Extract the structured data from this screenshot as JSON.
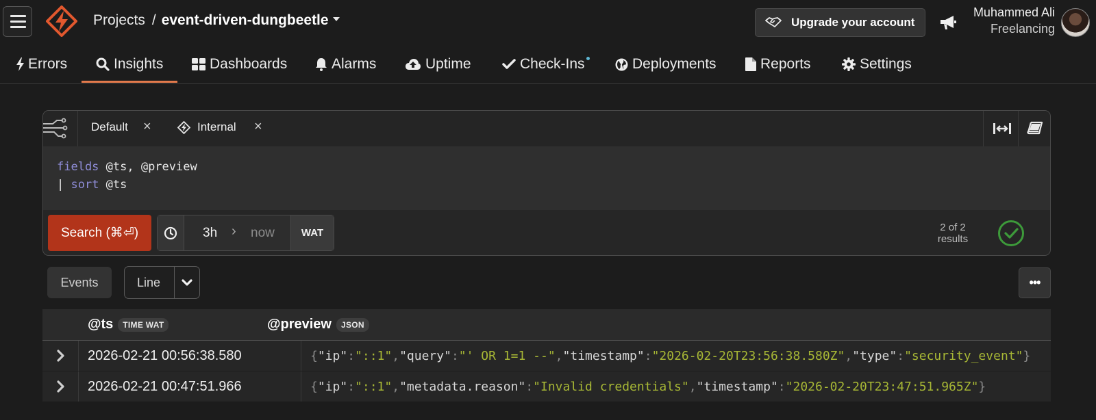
{
  "header": {
    "breadcrumb_root": "Projects",
    "breadcrumb_sep": "/",
    "project_name": "event-driven-dungbeetle",
    "upgrade_label": "Upgrade your account",
    "user_name": "Muhammed Ali",
    "user_org": "Freelancing",
    "brand_color": "#e2582e"
  },
  "nav": {
    "items": [
      {
        "label": "Errors",
        "icon": "bolt-icon"
      },
      {
        "label": "Insights",
        "icon": "search-icon",
        "active": true
      },
      {
        "label": "Dashboards",
        "icon": "grid-icon"
      },
      {
        "label": "Alarms",
        "icon": "bell-icon"
      },
      {
        "label": "Uptime",
        "icon": "cloud-upload-icon"
      },
      {
        "label": "Check-Ins",
        "icon": "check-icon"
      },
      {
        "label": "Deployments",
        "icon": "globe-icon"
      },
      {
        "label": "Reports",
        "icon": "file-icon"
      },
      {
        "label": "Settings",
        "icon": "gear-icon"
      }
    ],
    "accent_color": "#e27a4c"
  },
  "query": {
    "streams": [
      {
        "label": "Default",
        "close": "×"
      },
      {
        "label": "Internal",
        "close": "×"
      }
    ],
    "code_line1_kw": "fields",
    "code_line1_rest": " @ts, @preview",
    "code_line2_pipe": "| ",
    "code_line2_kw": "sort",
    "code_line2_rest": " @ts",
    "search_label": "Search (⌘⏎)",
    "time_from": "3h",
    "time_sep": "›",
    "time_to": "now",
    "timezone": "WAT",
    "results_count": "2 of 2",
    "results_label": "results"
  },
  "view": {
    "events_label": "Events",
    "display_mode": "Line",
    "more_label": "•••"
  },
  "table": {
    "columns": [
      {
        "name": "@ts",
        "badge": "TIME WAT"
      },
      {
        "name": "@preview",
        "badge": "JSON"
      }
    ],
    "rows": [
      {
        "ts": "2026-02-21 00:56:38.580",
        "preview": [
          [
            "ip",
            "::1"
          ],
          [
            "query",
            "' OR 1=1 --"
          ],
          [
            "timestamp",
            "2026-02-20T23:56:38.580Z"
          ],
          [
            "type",
            "security_event"
          ]
        ]
      },
      {
        "ts": "2026-02-21 00:47:51.966",
        "preview": [
          [
            "ip",
            "::1"
          ],
          [
            "metadata.reason",
            "Invalid credentials"
          ],
          [
            "timestamp",
            "2026-02-20T23:47:51.965Z"
          ]
        ]
      }
    ]
  }
}
